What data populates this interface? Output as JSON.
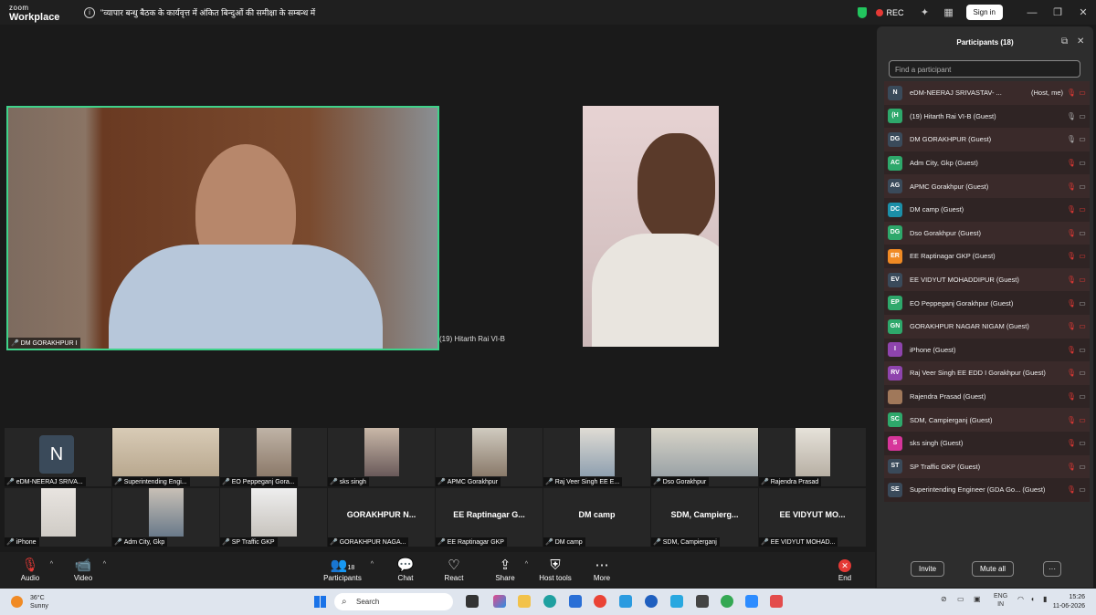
{
  "titlebar": {
    "logo_line1": "zoom",
    "logo_line2": "Workplace",
    "meeting_title": "\"व्यापार बन्धु बैठक के कार्यवृत्त में अंकित बिन्दुओं की समीक्षा के सम्बन्ध में",
    "rec_label": "REC",
    "signin_label": "Sign in"
  },
  "main_videos": [
    {
      "label": "DM GORAKHPUR I"
    },
    {
      "label": "(19) Hitarth Rai VI-B"
    }
  ],
  "gallery": [
    {
      "name": "eDM-NEERAJ SRIVA...",
      "avatar": "N"
    },
    {
      "name": "Superintending Engi..."
    },
    {
      "name": "EO Peppeganj Gora..."
    },
    {
      "name": "sks singh"
    },
    {
      "name": "APMC Gorakhpur"
    },
    {
      "name": "Raj Veer Singh EE E..."
    },
    {
      "name": "Dso Gorakhpur"
    },
    {
      "name": "Rajendra Prasad"
    },
    {
      "name": "iPhone"
    },
    {
      "name": "Adm City, Gkp"
    },
    {
      "name": "SP Traffic GKP"
    },
    {
      "name": "GORAKHPUR NAGA...",
      "big": "GORAKHPUR N..."
    },
    {
      "name": "EE Raptinagar GKP",
      "big": "EE Raptinagar G..."
    },
    {
      "name": "DM camp",
      "big": "DM camp"
    },
    {
      "name": "SDM, Campierganj",
      "big": "SDM, Campierg..."
    },
    {
      "name": "EE VIDYUT MOHAD...",
      "big": "EE VIDYUT MO..."
    }
  ],
  "toolbar": {
    "audio": "Audio",
    "video": "Video",
    "participants": "Participants",
    "participants_count": "18",
    "chat": "Chat",
    "react": "React",
    "share": "Share",
    "host_tools": "Host tools",
    "more": "More",
    "end": "End"
  },
  "panel": {
    "title": "Participants (18)",
    "search_placeholder": "Find a participant",
    "invite": "Invite",
    "mute_all": "Mute all",
    "more": "···",
    "participants": [
      {
        "initials": "N",
        "color": "#3a4a5a",
        "name": "eDM-NEERAJ SRIVASTAV- ...",
        "tag": "(Host, me)",
        "mic": "off",
        "cam": "off"
      },
      {
        "initials": "(H",
        "color": "#2ea86b",
        "name": "(19) Hitarth Rai VI-B (Guest)",
        "mic": "on",
        "cam": "on"
      },
      {
        "initials": "DG",
        "color": "#3a4a5a",
        "name": "DM GORAKHPUR (Guest)",
        "mic": "on",
        "cam": "on"
      },
      {
        "initials": "AC",
        "color": "#2ea86b",
        "name": "Adm City, Gkp (Guest)",
        "mic": "off",
        "cam": "on"
      },
      {
        "initials": "AG",
        "color": "#3a4a5a",
        "name": "APMC Gorakhpur (Guest)",
        "mic": "off",
        "cam": "on"
      },
      {
        "initials": "DC",
        "color": "#1b8fa8",
        "name": "DM camp (Guest)",
        "mic": "off",
        "cam": "off"
      },
      {
        "initials": "DG",
        "color": "#2ea86b",
        "name": "Dso Gorakhpur (Guest)",
        "mic": "off",
        "cam": "on"
      },
      {
        "initials": "ER",
        "color": "#f08a24",
        "name": "EE Raptinagar GKP (Guest)",
        "mic": "off",
        "cam": "off"
      },
      {
        "initials": "EV",
        "color": "#3a4a5a",
        "name": "EE VIDYUT MOHADDIPUR (Guest)",
        "mic": "off",
        "cam": "off"
      },
      {
        "initials": "EP",
        "color": "#2ea86b",
        "name": "EO Peppeganj Gorakhpur (Guest)",
        "mic": "off",
        "cam": "on"
      },
      {
        "initials": "GN",
        "color": "#2ea86b",
        "name": "GORAKHPUR NAGAR  NIGAM (Guest)",
        "mic": "off",
        "cam": "off"
      },
      {
        "initials": "I",
        "color": "#8e44ad",
        "name": "iPhone (Guest)",
        "mic": "off",
        "cam": "on"
      },
      {
        "initials": "RV",
        "color": "#8e44ad",
        "name": "Raj Veer Singh EE EDD I Gorakhpur (Guest)",
        "mic": "off",
        "cam": "on"
      },
      {
        "initials": "",
        "color": "#a0785a",
        "name": "Rajendra Prasad (Guest)",
        "mic": "off",
        "cam": "on"
      },
      {
        "initials": "SC",
        "color": "#2ea86b",
        "name": "SDM, Campierganj (Guest)",
        "mic": "off",
        "cam": "off"
      },
      {
        "initials": "S",
        "color": "#d6359a",
        "name": "sks singh (Guest)",
        "mic": "off",
        "cam": "on"
      },
      {
        "initials": "ST",
        "color": "#3a4a5a",
        "name": "SP Traffic GKP (Guest)",
        "mic": "off",
        "cam": "on"
      },
      {
        "initials": "SE",
        "color": "#3a4a5a",
        "name": "Superintending Engineer  (GDA Go... (Guest)",
        "mic": "off",
        "cam": "on"
      }
    ]
  },
  "taskbar": {
    "temp": "36°C",
    "weather": "Sunny",
    "search": "Search",
    "lang1": "ENG",
    "lang2": "IN",
    "time": "15:26",
    "date": "11-06-2026"
  }
}
